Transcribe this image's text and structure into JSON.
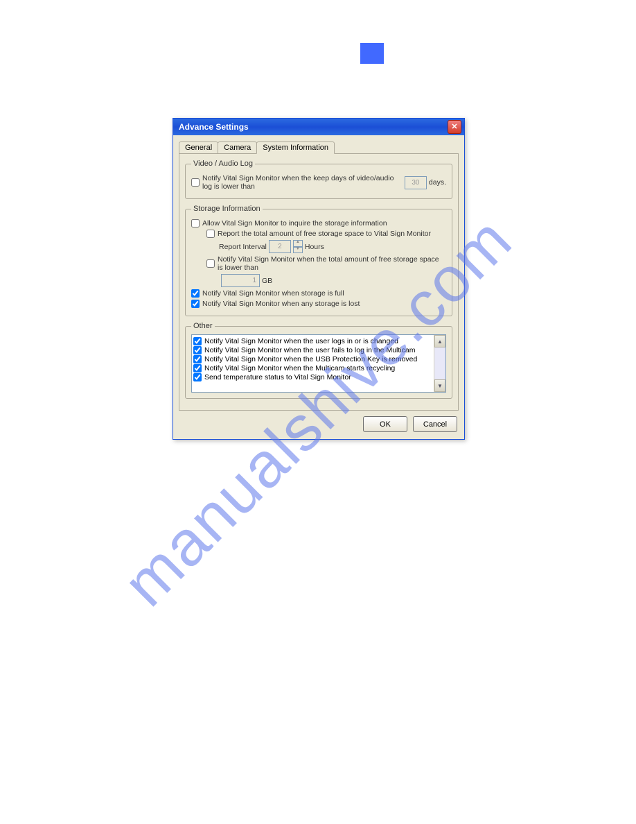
{
  "watermark": "manualshive.com",
  "dialog": {
    "title": "Advance Settings",
    "tabs": [
      "General",
      "Camera",
      "System Information"
    ],
    "active_tab": 2,
    "groups": {
      "video_audio": {
        "legend": "Video / Audio Log",
        "notify_keep_days": {
          "label_before": "Notify Vital Sign Monitor when the keep days of video/audio log is lower than",
          "value": "30",
          "label_after": "days.",
          "checked": false
        }
      },
      "storage": {
        "legend": "Storage Information",
        "allow_inquire": {
          "label": "Allow Vital Sign Monitor to inquire the storage information",
          "checked": false
        },
        "report_total": {
          "label": "Report the total amount of free storage space to Vital Sign Monitor",
          "checked": false
        },
        "report_interval": {
          "label_before": "Report Interval",
          "value": "2",
          "label_after": "Hours"
        },
        "notify_low": {
          "label": "Notify Vital Sign Monitor when the total amount of free storage space is lower than",
          "checked": false
        },
        "low_value": {
          "value": "1",
          "unit": "GB"
        },
        "notify_full": {
          "label": "Notify Vital Sign Monitor when storage is full",
          "checked": true
        },
        "notify_lost": {
          "label": "Notify Vital Sign Monitor when any storage is lost",
          "checked": true
        }
      },
      "other": {
        "legend": "Other",
        "items": [
          {
            "label": "Notify Vital Sign Monitor when the user logs in or is changed",
            "checked": true
          },
          {
            "label": "Notify Vital Sign Monitor when the user fails to log in the Multicam",
            "checked": true
          },
          {
            "label": "Notify Vital Sign Monitor when the USB Protection Key is removed",
            "checked": true
          },
          {
            "label": "Notify Vital Sign Monitor when the Multicam starts recycling",
            "checked": true
          },
          {
            "label": "Send temperature status to Vital Sign Monitor",
            "checked": true
          }
        ]
      }
    },
    "buttons": {
      "ok": "OK",
      "cancel": "Cancel"
    }
  }
}
